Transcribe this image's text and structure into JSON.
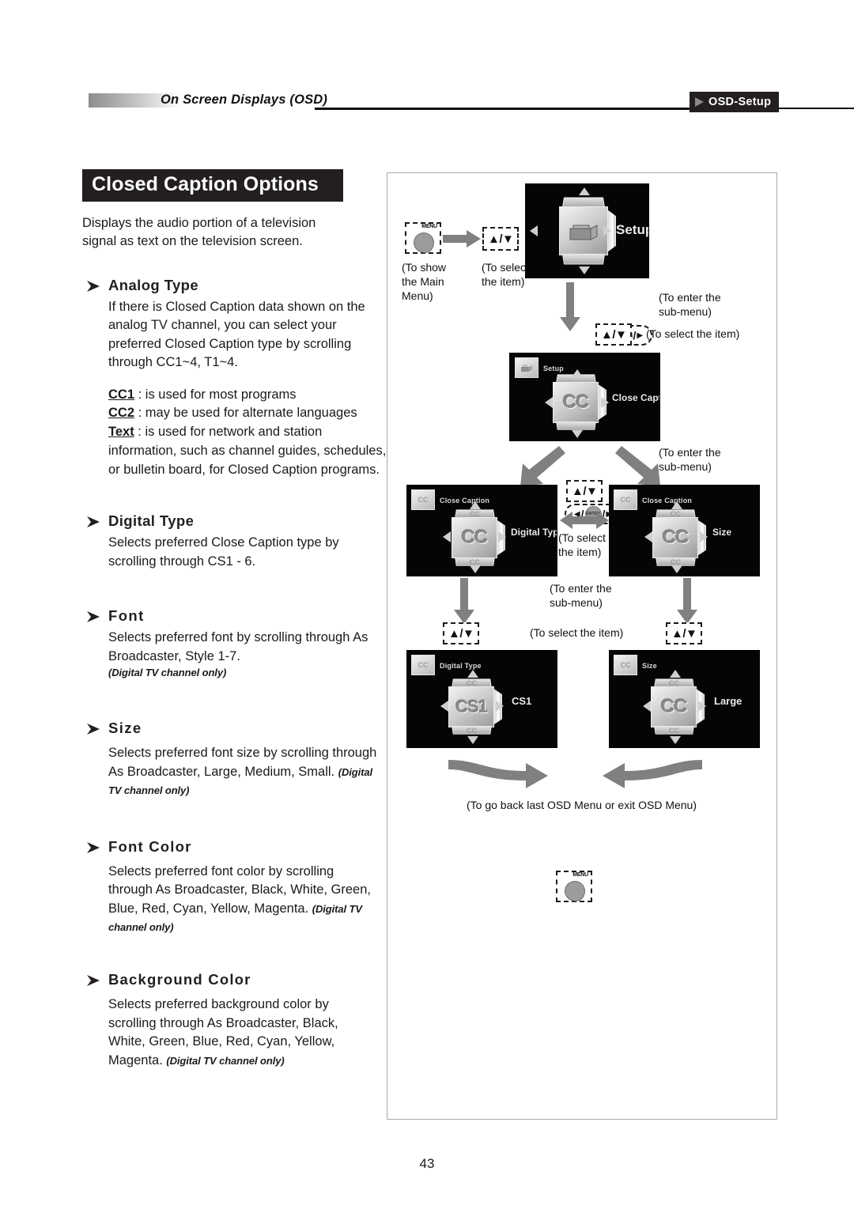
{
  "header": {
    "chapter": "On Screen Displays (OSD)",
    "badge": "OSD-Setup"
  },
  "page_number": "43",
  "left": {
    "title": "Closed Caption Options",
    "intro": "Displays the audio portion of a television signal as text on the television screen.",
    "sections": [
      {
        "heading": "Analog Type",
        "body": "If there is Closed Caption data shown on the analog TV channel, you can select your preferred Closed Caption type by scrolling through CC1~4, T1~4.",
        "note": "",
        "definitions": [
          {
            "term": "CC1",
            "text": ": is used for most programs"
          },
          {
            "term": "CC2",
            "text": ": may be used for alternate languages"
          },
          {
            "term": "Text",
            "text": ": is used for network and station information, such as channel guides, schedules, or bulletin board, for Closed Caption programs."
          }
        ]
      },
      {
        "heading": "Digital Type",
        "body": "Selects preferred Close Caption type by scrolling through CS1 - 6.",
        "note": ""
      },
      {
        "heading": "Font",
        "body": "Selects preferred font by scrolling through As Broadcaster, Style 1-7.",
        "note": "(Digital TV channel only)"
      },
      {
        "heading": "Size",
        "body": "Selects preferred font size by scrolling through As Broadcaster, Large, Medium, Small.",
        "note": "(Digital TV channel only)"
      },
      {
        "heading": "Font Color",
        "body": "Selects preferred font color by scrolling through As Broadcaster, Black, White, Green, Blue, Red, Cyan, Yellow, Magenta.",
        "note": "(Digital TV channel only)"
      },
      {
        "heading": "Background Color",
        "body": "Selects preferred background color by scrolling through As Broadcaster, Black, White, Green, Blue, Red, Cyan, Yellow, Magenta.",
        "note": "(Digital TV channel only)"
      }
    ]
  },
  "diagram": {
    "keys": {
      "menu": "MENU",
      "updown": "▲/▼",
      "enter": "ENTER"
    },
    "captions": {
      "show_main_menu": "(To show\nthe Main\nMenu)",
      "select_item_1": "(To select\nthe item)",
      "enter_submenu_1": "(To enter the\nsub-menu)",
      "select_item_2": "(To select the item)",
      "enter_submenu_2": "(To enter the\nsub-menu)",
      "select_item_3": "(To select\nthe item)",
      "enter_submenu_3": "(To enter the\nsub-menu)",
      "select_item_4": "(To select the item)",
      "go_back": "(To go back last OSD Menu or exit OSD Menu)"
    },
    "screens": [
      {
        "name": "setup-screen",
        "crumb": "",
        "label": "Setup",
        "cube_text": ""
      },
      {
        "name": "close-caption-screen",
        "crumb": "Setup",
        "label": "Close Caption",
        "cube_text": "CC"
      },
      {
        "name": "digital-type-screen",
        "crumb": "Close Caption",
        "label": "Digital Type",
        "cube_text": "CC"
      },
      {
        "name": "size-screen",
        "crumb": "Close Caption",
        "label": "Size",
        "cube_text": "CC"
      },
      {
        "name": "cs1-screen",
        "crumb": "Digital Type",
        "label": "CS1",
        "cube_text": "CS1"
      },
      {
        "name": "large-screen",
        "crumb": "Size",
        "label": "Large",
        "cube_text": "CC"
      }
    ]
  }
}
